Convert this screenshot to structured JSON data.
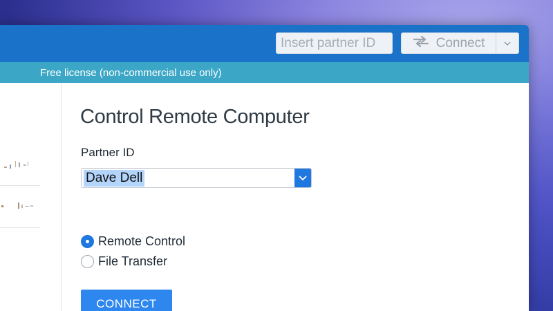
{
  "toolbar": {
    "partner_id_placeholder": "Insert partner ID",
    "connect_label": "Connect",
    "arrow_icon": "swap-arrows-icon",
    "dropdown_icon": "chevron-down-icon"
  },
  "license_bar": {
    "text": "Free license (non-commercial use only)"
  },
  "main": {
    "title": "Control Remote Computer",
    "partner_label": "Partner ID",
    "partner_value": "Dave Dell",
    "options": [
      {
        "label": "Remote Control",
        "checked": true
      },
      {
        "label": "File Transfer",
        "checked": false
      }
    ],
    "connect_button": "CONNECT"
  },
  "colors": {
    "toolbar": "#1a73c9",
    "license_bar": "#3ba6c6",
    "accent": "#2d87ef"
  }
}
